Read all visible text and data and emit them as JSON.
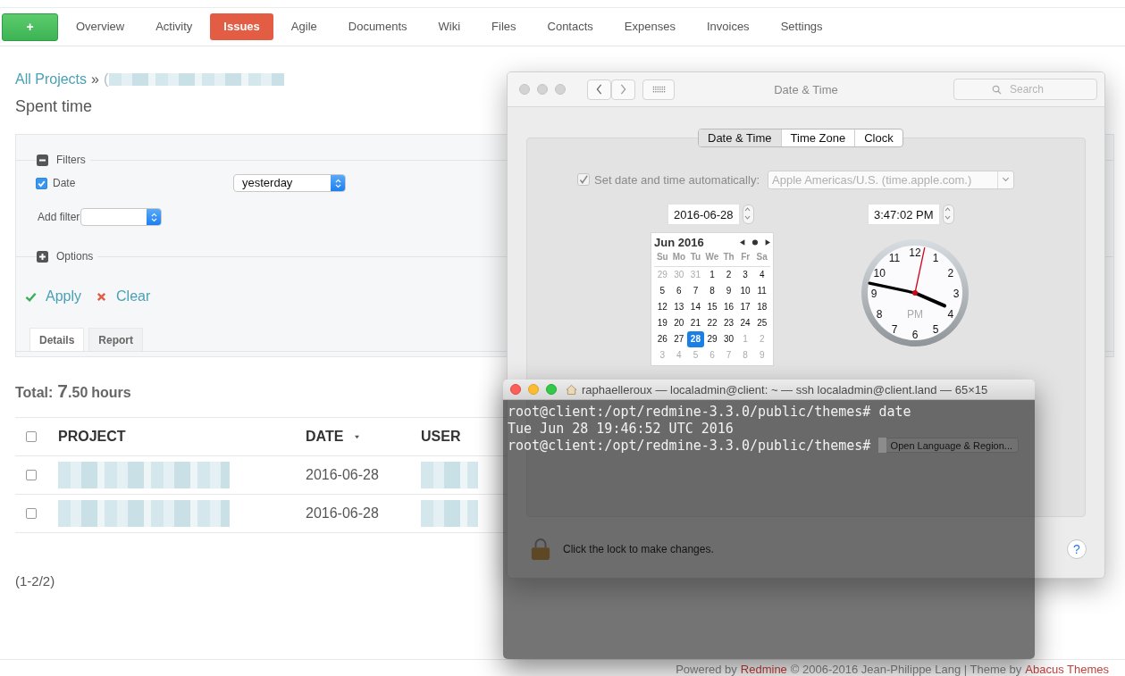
{
  "nav": {
    "new_button": "+",
    "items": [
      {
        "label": "Overview",
        "selected": false
      },
      {
        "label": "Activity",
        "selected": false
      },
      {
        "label": "Issues",
        "selected": true
      },
      {
        "label": "Agile",
        "selected": false
      },
      {
        "label": "Documents",
        "selected": false
      },
      {
        "label": "Wiki",
        "selected": false
      },
      {
        "label": "Files",
        "selected": false
      },
      {
        "label": "Contacts",
        "selected": false
      },
      {
        "label": "Expenses",
        "selected": false
      },
      {
        "label": "Invoices",
        "selected": false
      },
      {
        "label": "Settings",
        "selected": false
      }
    ]
  },
  "breadcrumb": {
    "link": "All Projects",
    "separator": "»",
    "tail": "("
  },
  "title": "Spent time",
  "filters": {
    "legend": "Filters",
    "expanded": true,
    "rows": [
      {
        "label": "Date",
        "checked": true,
        "operator": "yesterday"
      }
    ],
    "add_filter_label": "Add filter"
  },
  "options": {
    "legend": "Options",
    "expanded": false
  },
  "actions": [
    {
      "label": "Apply",
      "kind": "apply"
    },
    {
      "label": "Clear",
      "kind": "clear"
    }
  ],
  "tabs": [
    {
      "label": "Details",
      "selected": true
    },
    {
      "label": "Report",
      "selected": false
    }
  ],
  "total": {
    "label": "Total:",
    "whole": "7",
    "fraction": ".50",
    "unit": "hours"
  },
  "table": {
    "all_checked": false,
    "columns": [
      {
        "label": "PROJECT",
        "sorted": false
      },
      {
        "label": "DATE",
        "sorted": true
      },
      {
        "label": "USER",
        "sorted": false
      }
    ],
    "rows": [
      {
        "checked": false,
        "date": "2016-06-28"
      },
      {
        "checked": false,
        "date": "2016-06-28"
      }
    ]
  },
  "pagination": "(1-2/2)",
  "footer": [
    {
      "text": "Powered by",
      "kind": "text"
    },
    {
      "text": "Redmine",
      "kind": "link"
    },
    {
      "text": "© 2006-2016 Jean-Philippe Lang | Theme by",
      "kind": "text"
    },
    {
      "text": "Abacus Themes",
      "kind": "link"
    }
  ],
  "prefs": {
    "title": "Date & Time",
    "search_placeholder": "Search",
    "tabs": [
      {
        "label": "Date & Time",
        "selected": true
      },
      {
        "label": "Time Zone",
        "selected": false
      },
      {
        "label": "Clock",
        "selected": false
      }
    ],
    "auto": {
      "label": "Set date and time automatically:",
      "checked": true,
      "disabled": true,
      "server": "Apple Americas/U.S. (time.apple.com.)"
    },
    "date": "2016-06-28",
    "time": "3:47:02 PM",
    "calendar": {
      "month": "Jun 2016",
      "weekdays": [
        "Su",
        "Mo",
        "Tu",
        "We",
        "Th",
        "Fr",
        "Sa"
      ],
      "weeks": [
        [
          {
            "day": "29",
            "in_month": false,
            "selected": false
          },
          {
            "day": "30",
            "in_month": false,
            "selected": false
          },
          {
            "day": "31",
            "in_month": false,
            "selected": false
          },
          {
            "day": "1",
            "in_month": true,
            "selected": false
          },
          {
            "day": "2",
            "in_month": true,
            "selected": false
          },
          {
            "day": "3",
            "in_month": true,
            "selected": false
          },
          {
            "day": "4",
            "in_month": true,
            "selected": false
          }
        ],
        [
          {
            "day": "5",
            "in_month": true,
            "selected": false
          },
          {
            "day": "6",
            "in_month": true,
            "selected": false
          },
          {
            "day": "7",
            "in_month": true,
            "selected": false
          },
          {
            "day": "8",
            "in_month": true,
            "selected": false
          },
          {
            "day": "9",
            "in_month": true,
            "selected": false
          },
          {
            "day": "10",
            "in_month": true,
            "selected": false
          },
          {
            "day": "11",
            "in_month": true,
            "selected": false
          }
        ],
        [
          {
            "day": "12",
            "in_month": true,
            "selected": false
          },
          {
            "day": "13",
            "in_month": true,
            "selected": false
          },
          {
            "day": "14",
            "in_month": true,
            "selected": false
          },
          {
            "day": "15",
            "in_month": true,
            "selected": false
          },
          {
            "day": "16",
            "in_month": true,
            "selected": false
          },
          {
            "day": "17",
            "in_month": true,
            "selected": false
          },
          {
            "day": "18",
            "in_month": true,
            "selected": false
          }
        ],
        [
          {
            "day": "19",
            "in_month": true,
            "selected": false
          },
          {
            "day": "20",
            "in_month": true,
            "selected": false
          },
          {
            "day": "21",
            "in_month": true,
            "selected": false
          },
          {
            "day": "22",
            "in_month": true,
            "selected": false
          },
          {
            "day": "23",
            "in_month": true,
            "selected": false
          },
          {
            "day": "24",
            "in_month": true,
            "selected": false
          },
          {
            "day": "25",
            "in_month": true,
            "selected": false
          }
        ],
        [
          {
            "day": "26",
            "in_month": true,
            "selected": false
          },
          {
            "day": "27",
            "in_month": true,
            "selected": false
          },
          {
            "day": "28",
            "in_month": true,
            "selected": true
          },
          {
            "day": "29",
            "in_month": true,
            "selected": false
          },
          {
            "day": "30",
            "in_month": true,
            "selected": false
          },
          {
            "day": "1",
            "in_month": false,
            "selected": false
          },
          {
            "day": "2",
            "in_month": false,
            "selected": false
          }
        ],
        [
          {
            "day": "3",
            "in_month": false,
            "selected": false
          },
          {
            "day": "4",
            "in_month": false,
            "selected": false
          },
          {
            "day": "5",
            "in_month": false,
            "selected": false
          },
          {
            "day": "6",
            "in_month": false,
            "selected": false
          },
          {
            "day": "7",
            "in_month": false,
            "selected": false
          },
          {
            "day": "8",
            "in_month": false,
            "selected": false
          },
          {
            "day": "9",
            "in_month": false,
            "selected": false
          }
        ]
      ]
    },
    "clock": {
      "numbers": [
        "12",
        "1",
        "2",
        "3",
        "4",
        "5",
        "6",
        "7",
        "8",
        "9",
        "10",
        "11"
      ],
      "meridiem": "PM"
    },
    "region_button": "Open Language & Region...",
    "lock_text": "Click the lock to make changes.",
    "help_button": "?"
  },
  "terminal": {
    "title": "raphaelleroux — localadmin@client: ~ — ssh localadmin@client.land — 65×15",
    "lines": [
      "root@client:/opt/redmine-3.3.0/public/themes# date",
      "Tue Jun 28 19:46:52 UTC 2016",
      "root@client:/opt/redmine-3.3.0/public/themes#"
    ]
  }
}
